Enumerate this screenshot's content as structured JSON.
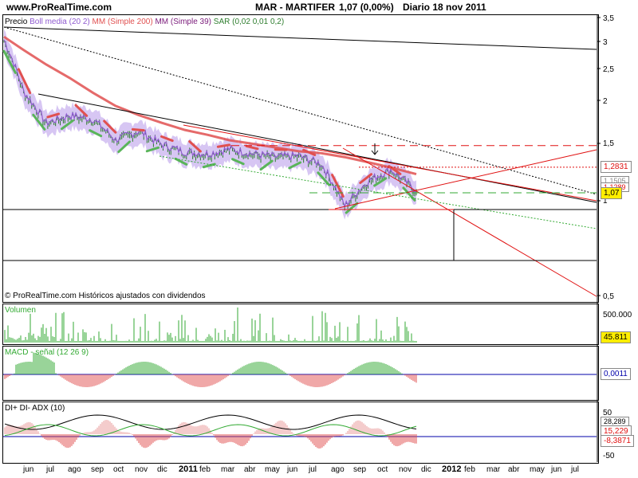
{
  "header": {
    "site": "www.ProRealTime.com",
    "symbol": "MAR - MARTIFER",
    "last": "1,07 (0,00%)",
    "period": "Diario  18 nov 2011"
  },
  "main": {
    "indicators_prefix": "Precio",
    "boll_label": "Boll media (20 2)",
    "mm200_label": "MM (Simple 200)",
    "mm39_label": "MM (Simple 39)",
    "sar_label": "SAR (0,02 0,01 0,2)",
    "copyright": "© ProRealTime.com Históricos ajustados con dividendos",
    "y_ticks": [
      "3,5",
      "3",
      "2,5",
      "2",
      "1,5",
      "1",
      "0,5"
    ],
    "badges": {
      "level1": "1,2831",
      "level2": "1,1505",
      "level3": "1,1289",
      "last": "1,07"
    }
  },
  "volume": {
    "label": "Volumen",
    "tick": "500.000",
    "badge": "45.811"
  },
  "macd": {
    "label": "MACD - señal (12 26 9)",
    "badge": "0,0011"
  },
  "adx": {
    "label": "DI+ DI- ADX (10)",
    "ticks": [
      "50",
      "-50"
    ],
    "badges": {
      "v1": "28,289",
      "v2": "15,229",
      "v3": "-8,3871"
    }
  },
  "xaxis": {
    "labels": [
      "jun",
      "jul",
      "ago",
      "sep",
      "oct",
      "nov",
      "dic",
      "2011",
      "feb",
      "mar",
      "abr",
      "may",
      "jun",
      "jul",
      "ago",
      "sep",
      "oct",
      "nov",
      "dic",
      "2012",
      "feb",
      "mar",
      "abr",
      "may",
      "jun",
      "jul"
    ]
  },
  "colors": {
    "price": "#2d7d2d",
    "boll": "#8f5bd0",
    "boll_band": "#cdb8f0",
    "mm200": "#e05050",
    "mm39": "#7a1a7a",
    "sar": "#5ab55a",
    "trend_red": "#e01010",
    "volume": "#33aa33",
    "macd": "#33aa33",
    "adx": "#000000",
    "di_plus": "#33aa33",
    "di_minus": "#e05050",
    "axis_line": "#0000aa"
  },
  "chart_data": [
    {
      "type": "line",
      "title": "MAR - MARTIFER",
      "x": [
        "2010-05-20",
        "2010-06-15",
        "2010-07-15",
        "2010-08-15",
        "2010-09-15",
        "2010-10-15",
        "2010-11-15",
        "2010-12-15",
        "2011-01-15",
        "2011-02-15",
        "2011-03-15",
        "2011-04-15",
        "2011-05-15",
        "2011-06-15",
        "2011-07-15",
        "2011-08-15",
        "2011-09-15",
        "2011-10-15",
        "2011-11-18"
      ],
      "series": [
        {
          "name": "Precio",
          "values": [
            3.2,
            2.2,
            1.75,
            1.85,
            1.8,
            1.55,
            1.65,
            1.5,
            1.42,
            1.4,
            1.45,
            1.4,
            1.37,
            1.38,
            1.3,
            0.96,
            1.15,
            1.25,
            1.07
          ]
        },
        {
          "name": "MM (Simple 200)",
          "values": [
            3.3,
            3.0,
            2.7,
            2.45,
            2.2,
            2.0,
            1.87,
            1.77,
            1.68,
            1.62,
            1.56,
            1.52,
            1.48,
            1.44,
            1.42,
            1.38,
            1.33,
            1.28,
            1.22
          ]
        }
      ],
      "ylim": [
        0.45,
        3.6
      ],
      "yscale": "log",
      "horizontal_levels": [
        1.5,
        1.2831,
        1.07
      ],
      "grid": false
    },
    {
      "type": "bar",
      "title": "Volumen",
      "last_value": 45811
    },
    {
      "type": "bar",
      "title": "MACD - señal (12 26 9)",
      "last_value": 0.0011
    },
    {
      "type": "line",
      "title": "DI+ DI- ADX (10)",
      "values": {
        "ADX": 28.289,
        "DI+": 15.229,
        "DI-": -8.3871
      },
      "ylim": [
        -50,
        50
      ]
    }
  ]
}
